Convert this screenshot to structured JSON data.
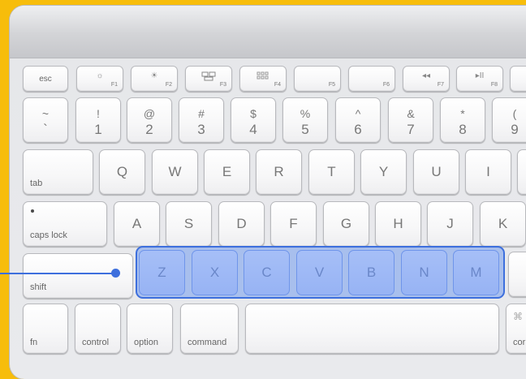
{
  "colors": {
    "background": "#f7bd0b",
    "highlight": "#3d6fdd",
    "highlight_fill": "#97b3f4"
  },
  "function_row": [
    {
      "id": "esc",
      "label": "esc",
      "icon": ""
    },
    {
      "id": "f1",
      "label": "F1",
      "icon": "brightness-down-icon"
    },
    {
      "id": "f2",
      "label": "F2",
      "icon": "brightness-up-icon"
    },
    {
      "id": "f3",
      "label": "F3",
      "icon": "mission-control-icon"
    },
    {
      "id": "f4",
      "label": "F4",
      "icon": "dashboard-icon"
    },
    {
      "id": "f5",
      "label": "F5",
      "icon": ""
    },
    {
      "id": "f6",
      "label": "F6",
      "icon": ""
    },
    {
      "id": "f7",
      "label": "F7",
      "icon": "rewind-icon"
    },
    {
      "id": "f8",
      "label": "F8",
      "icon": "play-pause-icon"
    }
  ],
  "number_row": [
    {
      "top": "~",
      "bottom": "`"
    },
    {
      "top": "!",
      "bottom": "1"
    },
    {
      "top": "@",
      "bottom": "2"
    },
    {
      "top": "#",
      "bottom": "3"
    },
    {
      "top": "$",
      "bottom": "4"
    },
    {
      "top": "%",
      "bottom": "5"
    },
    {
      "top": "^",
      "bottom": "6"
    },
    {
      "top": "&",
      "bottom": "7"
    },
    {
      "top": "*",
      "bottom": "8"
    },
    {
      "top": "(",
      "bottom": "9"
    }
  ],
  "qwerty_row": {
    "tab": "tab",
    "letters": [
      "Q",
      "W",
      "E",
      "R",
      "T",
      "Y",
      "U",
      "I"
    ]
  },
  "home_row": {
    "caps_lock": "caps lock",
    "letters": [
      "A",
      "S",
      "D",
      "F",
      "G",
      "H",
      "J",
      "K"
    ]
  },
  "shift_row": {
    "shift": "shift",
    "letters": [
      "Z",
      "X",
      "C",
      "V",
      "B",
      "N",
      "M"
    ]
  },
  "bottom_row": {
    "fn": "fn",
    "control": "control",
    "option": "option",
    "command": "command",
    "cmd_symbol": "⌘",
    "right_command": "cor"
  },
  "highlight": {
    "row": "shift_row",
    "keys": [
      "Z",
      "X",
      "C",
      "V",
      "B",
      "N",
      "M"
    ]
  }
}
